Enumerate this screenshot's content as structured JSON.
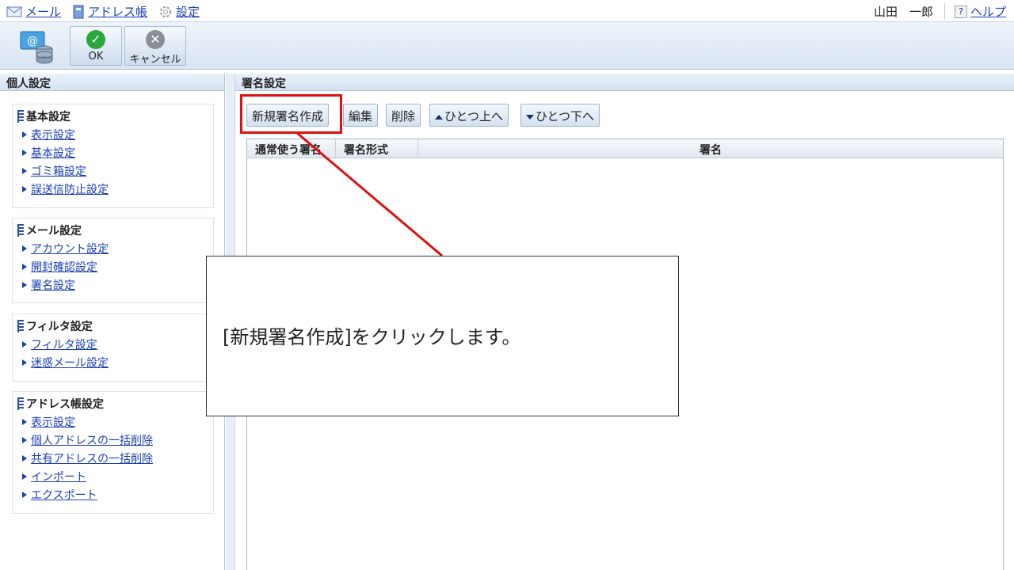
{
  "topbar": {
    "nav": [
      {
        "icon": "envelope-icon",
        "label": "メール"
      },
      {
        "icon": "address-book-icon",
        "label": "アドレス帳"
      },
      {
        "icon": "gear-icon",
        "label": "設定"
      }
    ],
    "user_name": "山田　一郎",
    "help_icon": "?",
    "help_label": "ヘルプ"
  },
  "toolbar": {
    "ok_label": "OK",
    "cancel_label": "キャンセル",
    "ok_color": "#2aa63a",
    "cancel_color": "#8a8f96"
  },
  "left": {
    "title": "個人設定",
    "groups": [
      {
        "title": "基本設定",
        "items": [
          "表示設定",
          "基本設定",
          "ゴミ箱設定",
          "誤送信防止設定"
        ]
      },
      {
        "title": "メール設定",
        "items": [
          "アカウント設定",
          "開封確認設定",
          "署名設定"
        ]
      },
      {
        "title": "フィルタ設定",
        "items": [
          "フィルタ設定",
          "迷惑メール設定"
        ]
      },
      {
        "title": "アドレス帳設定",
        "items": [
          "表示設定",
          "個人アドレスの一括削除",
          "共有アドレスの一括削除",
          "インポート",
          "エクスポート"
        ]
      }
    ]
  },
  "main": {
    "title": "署名設定",
    "buttons": {
      "new": "新規署名作成",
      "edit": "編集",
      "delete": "削除",
      "up": "ひとつ上へ",
      "down": "ひとつ下へ"
    },
    "columns": [
      "通常使う署名",
      "署名形式",
      "署名"
    ]
  },
  "callout": {
    "text": "[新規署名作成]をクリックします。",
    "color": "#e01010"
  }
}
